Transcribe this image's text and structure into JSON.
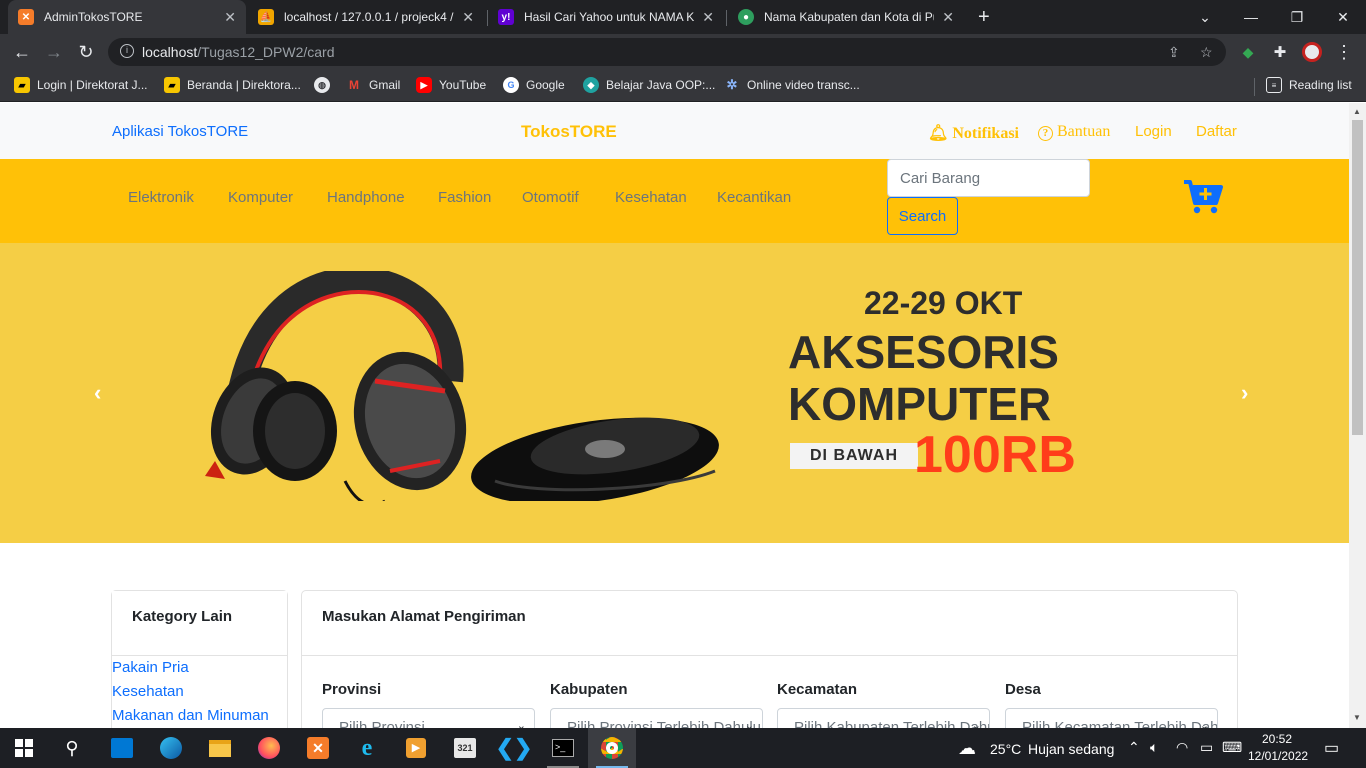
{
  "browser": {
    "tabs": [
      {
        "title": "AdminTokosTORE",
        "favicon_color": "#f57c2a"
      },
      {
        "title": "localhost / 127.0.0.1 / projeck4 / ...",
        "favicon_color": "#f0a500"
      },
      {
        "title": "Hasil Cari Yahoo untuk NAMA KA...",
        "favicon_color": "#6001d2"
      },
      {
        "title": "Nama Kabupaten dan Kota di Pul...",
        "favicon_color": "#2e9e5e"
      }
    ],
    "url_host": "localhost",
    "url_path": "/Tugas12_DPW2/card",
    "bookmarks": [
      {
        "label": "Login | Direktorat J...",
        "color": "#f7c600"
      },
      {
        "label": "Beranda | Direktora...",
        "color": "#f7c600"
      },
      {
        "label": "",
        "color": "#e8eaed"
      },
      {
        "label": "Gmail",
        "color": "#ea4335"
      },
      {
        "label": "YouTube",
        "color": "#ff0000"
      },
      {
        "label": "Google",
        "color": "#4285f4"
      },
      {
        "label": "Belajar Java OOP:...",
        "color": "#1fa2a0"
      },
      {
        "label": "Online video transc...",
        "color": "#8ab4f8"
      }
    ],
    "reading_list": "Reading list"
  },
  "site": {
    "brand_left": "Aplikasi TokosTORE",
    "brand_center": "TokosTORE",
    "notifikasi": "Notifikasi",
    "bantuan": "Bantuan",
    "login": "Login",
    "daftar": "Daftar",
    "categories": [
      "Elektronik",
      "Komputer",
      "Handphone",
      "Fashion",
      "Otomotif",
      "Kesehatan",
      "Kecantikan"
    ],
    "search_placeholder": "Cari Barang",
    "search_button": "Search",
    "accent": "#ffc107",
    "link_color": "#0d6efd"
  },
  "banner": {
    "date": "22-29 OKT",
    "line1": "AKSESORIS",
    "line2": "KOMPUTER",
    "under": "DI BAWAH",
    "price": "100RB",
    "prev": "‹",
    "next": "›"
  },
  "sidebar": {
    "title": "Kategory Lain",
    "links": [
      "Pakain Pria",
      "Kesehatan",
      "Makanan dan Minuman"
    ]
  },
  "shipping": {
    "title": "Masukan Alamat Pengiriman",
    "fields": [
      {
        "label": "Provinsi",
        "placeholder": "Pilih Provinsi"
      },
      {
        "label": "Kabupaten",
        "placeholder": "Pilih Provinsi Terlebih Dahulu"
      },
      {
        "label": "Kecamatan",
        "placeholder": "Pilih Kabupaten Terlebih Dahulu"
      },
      {
        "label": "Desa",
        "placeholder": "Pilih Kecamatan Terlebih Dahulu"
      }
    ]
  },
  "taskbar": {
    "weather_temp": "25°C",
    "weather_desc": "Hujan sedang",
    "time": "20:52",
    "date": "12/01/2022"
  }
}
